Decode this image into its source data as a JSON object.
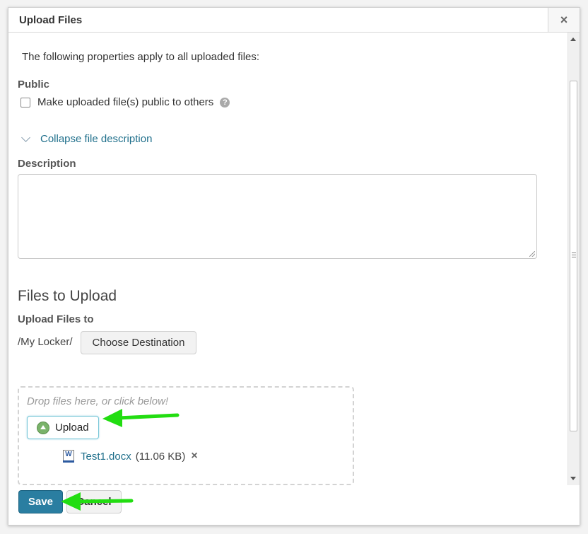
{
  "dialog": {
    "title": "Upload Files",
    "close_symbol": "×"
  },
  "properties": {
    "intro": "The following properties apply to all uploaded files:",
    "public_label": "Public",
    "public_checkbox_label": "Make uploaded file(s) public to others",
    "public_checked": false,
    "help_symbol": "?",
    "collapse_link": "Collapse file description",
    "description_label": "Description",
    "description_value": ""
  },
  "files": {
    "heading": "Files to Upload",
    "upload_to_label": "Upload Files to",
    "path": "/My Locker/",
    "choose_destination": "Choose Destination",
    "drop_hint": "Drop files here, or click below!",
    "upload_button": "Upload",
    "items": [
      {
        "name": "Test1.docx",
        "size": "(11.06 KB)",
        "icon": "word-doc-icon"
      }
    ],
    "remove_symbol": "×"
  },
  "footer": {
    "save": "Save",
    "cancel": "Cancel"
  },
  "colors": {
    "primary_button": "#2a7ea1",
    "link": "#1f6f8b",
    "annotation_arrow": "#22dd11"
  }
}
